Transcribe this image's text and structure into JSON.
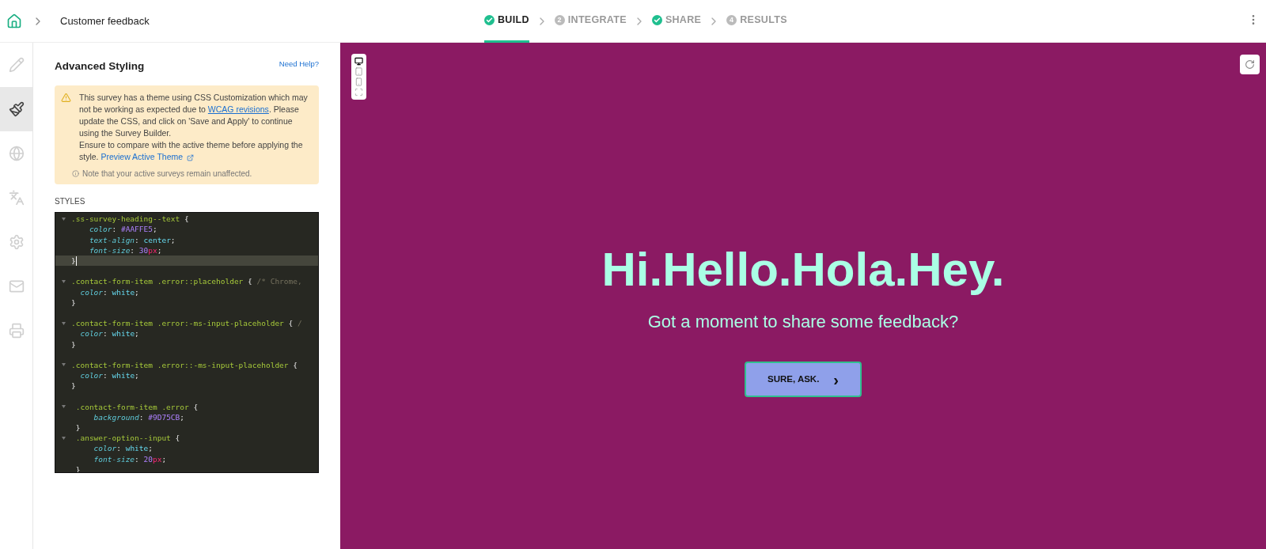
{
  "breadcrumb": {
    "title": "Customer feedback"
  },
  "steps": [
    {
      "label": "BUILD",
      "kind": "done",
      "selected": true
    },
    {
      "label": "INTEGRATE",
      "kind": "numbered",
      "number": "2",
      "selected": false
    },
    {
      "label": "SHARE",
      "kind": "done",
      "selected": false
    },
    {
      "label": "RESULTS",
      "kind": "numbered",
      "number": "4",
      "selected": false
    }
  ],
  "sidebar": {
    "items": [
      {
        "kind": "pencil",
        "selected": false
      },
      {
        "kind": "brush",
        "selected": true
      },
      {
        "kind": "globe",
        "selected": false
      },
      {
        "kind": "translate",
        "selected": false
      },
      {
        "kind": "gear",
        "selected": false
      },
      {
        "kind": "mail",
        "selected": false
      },
      {
        "kind": "printer",
        "selected": false
      }
    ]
  },
  "panel": {
    "title": "Advanced Styling",
    "help_link": "Need Help?",
    "warning": {
      "before": "This survey has a theme using CSS Customization which may not be working as expected due to ",
      "link": "WCAG revisions",
      "after": ". Please update the CSS, and click on 'Save and Apply' to continue using the Survey Builder.",
      "line2": "Ensure to compare with the active theme before applying the style. ",
      "preview_link": "Preview Active Theme",
      "note": "Note that your active surveys remain unaffected."
    },
    "styles_label": "STYLES",
    "code": [
      {
        "kind": "code",
        "fold": true,
        "active": false,
        "tokens": [
          {
            "kind": "sel",
            "s": ".ss-survey-heading--text"
          },
          {
            "kind": "p",
            "s": " {"
          }
        ]
      },
      {
        "kind": "code",
        "fold": false,
        "active": false,
        "tokens": [
          {
            "kind": "prop",
            "s": "    color"
          },
          {
            "kind": "p",
            "s": ": "
          },
          {
            "kind": "num",
            "s": "#AAFFE5"
          },
          {
            "kind": "p",
            "s": ";"
          }
        ]
      },
      {
        "kind": "code",
        "fold": false,
        "active": false,
        "tokens": [
          {
            "kind": "prop",
            "s": "    text-align"
          },
          {
            "kind": "p",
            "s": ": "
          },
          {
            "kind": "val",
            "s": "center"
          },
          {
            "kind": "p",
            "s": ";"
          }
        ]
      },
      {
        "kind": "code",
        "fold": false,
        "active": false,
        "tokens": [
          {
            "kind": "prop",
            "s": "    font-size"
          },
          {
            "kind": "p",
            "s": ": "
          },
          {
            "kind": "num",
            "s": "30"
          },
          {
            "kind": "unit",
            "s": "px"
          },
          {
            "kind": "p",
            "s": ";"
          }
        ]
      },
      {
        "kind": "code",
        "fold": false,
        "active": true,
        "tokens": [
          {
            "kind": "p",
            "s": "}"
          }
        ]
      },
      {
        "kind": "blank"
      },
      {
        "kind": "code",
        "fold": true,
        "active": false,
        "tokens": [
          {
            "kind": "sel",
            "s": ".contact-form-item .error::placeholder"
          },
          {
            "kind": "p",
            "s": " { "
          },
          {
            "kind": "com",
            "s": "/* Chrome,"
          }
        ]
      },
      {
        "kind": "code",
        "fold": false,
        "active": false,
        "tokens": [
          {
            "kind": "prop",
            "s": "  color"
          },
          {
            "kind": "p",
            "s": ": "
          },
          {
            "kind": "val",
            "s": "white"
          },
          {
            "kind": "p",
            "s": ";"
          }
        ]
      },
      {
        "kind": "code",
        "fold": false,
        "active": false,
        "tokens": [
          {
            "kind": "p",
            "s": "}"
          }
        ]
      },
      {
        "kind": "blank"
      },
      {
        "kind": "code",
        "fold": true,
        "active": false,
        "tokens": [
          {
            "kind": "sel",
            "s": ".contact-form-item .error:-ms-input-placeholder"
          },
          {
            "kind": "p",
            "s": " { "
          },
          {
            "kind": "com",
            "s": "/"
          }
        ]
      },
      {
        "kind": "code",
        "fold": false,
        "active": false,
        "tokens": [
          {
            "kind": "prop",
            "s": "  color"
          },
          {
            "kind": "p",
            "s": ": "
          },
          {
            "kind": "val",
            "s": "white"
          },
          {
            "kind": "p",
            "s": ";"
          }
        ]
      },
      {
        "kind": "code",
        "fold": false,
        "active": false,
        "tokens": [
          {
            "kind": "p",
            "s": "}"
          }
        ]
      },
      {
        "kind": "blank"
      },
      {
        "kind": "code",
        "fold": true,
        "active": false,
        "tokens": [
          {
            "kind": "sel",
            "s": ".contact-form-item .error::-ms-input-placeholder"
          },
          {
            "kind": "p",
            "s": " {"
          }
        ]
      },
      {
        "kind": "code",
        "fold": false,
        "active": false,
        "tokens": [
          {
            "kind": "prop",
            "s": "  color"
          },
          {
            "kind": "p",
            "s": ": "
          },
          {
            "kind": "val",
            "s": "white"
          },
          {
            "kind": "p",
            "s": ";"
          }
        ]
      },
      {
        "kind": "code",
        "fold": false,
        "active": false,
        "tokens": [
          {
            "kind": "p",
            "s": "}"
          }
        ]
      },
      {
        "kind": "blank"
      },
      {
        "kind": "code",
        "fold": true,
        "active": false,
        "tokens": [
          {
            "kind": "sel",
            "s": " .contact-form-item .error"
          },
          {
            "kind": "p",
            "s": " {"
          }
        ]
      },
      {
        "kind": "code",
        "fold": false,
        "active": false,
        "tokens": [
          {
            "kind": "prop",
            "s": "     background"
          },
          {
            "kind": "p",
            "s": ": "
          },
          {
            "kind": "num",
            "s": "#9D75CB"
          },
          {
            "kind": "p",
            "s": ";"
          }
        ]
      },
      {
        "kind": "code",
        "fold": false,
        "active": false,
        "tokens": [
          {
            "kind": "p",
            "s": " }"
          }
        ]
      },
      {
        "kind": "code",
        "fold": true,
        "active": false,
        "tokens": [
          {
            "kind": "sel",
            "s": " .answer-option--input"
          },
          {
            "kind": "p",
            "s": " {"
          }
        ]
      },
      {
        "kind": "code",
        "fold": false,
        "active": false,
        "tokens": [
          {
            "kind": "prop",
            "s": "     color"
          },
          {
            "kind": "p",
            "s": ": "
          },
          {
            "kind": "val",
            "s": "white"
          },
          {
            "kind": "p",
            "s": ";"
          }
        ]
      },
      {
        "kind": "code",
        "fold": false,
        "active": false,
        "tokens": [
          {
            "kind": "prop",
            "s": "     font-size"
          },
          {
            "kind": "p",
            "s": ": "
          },
          {
            "kind": "num",
            "s": "20"
          },
          {
            "kind": "unit",
            "s": "px"
          },
          {
            "kind": "p",
            "s": ";"
          }
        ]
      },
      {
        "kind": "code",
        "fold": false,
        "active": false,
        "tokens": [
          {
            "kind": "p",
            "s": " }"
          }
        ]
      }
    ]
  },
  "preview": {
    "devices": [
      {
        "kind": "desktop",
        "selected": true
      },
      {
        "kind": "tablet",
        "selected": false
      },
      {
        "kind": "phone",
        "selected": false
      },
      {
        "kind": "fullscreen",
        "selected": false
      }
    ],
    "heading": "Hi.Hello.Hola.Hey.",
    "subheading": "Got a moment to share some feedback?",
    "button": "SURE, ASK.",
    "button_icon": "›"
  }
}
